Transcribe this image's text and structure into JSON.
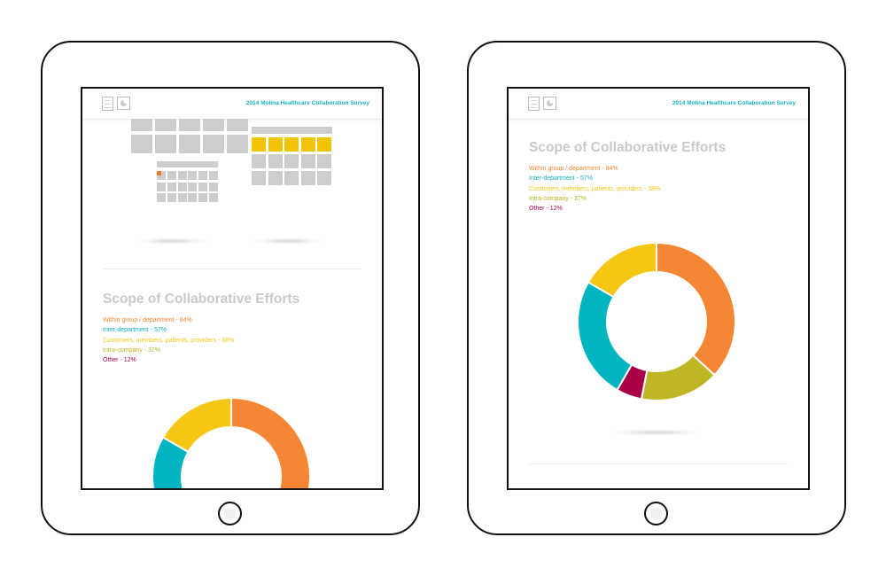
{
  "app": {
    "survey_title": "2014 Molina Healthcare Collaboration Survey",
    "icons": [
      "document-icon",
      "pie-chart-icon"
    ]
  },
  "section": {
    "title": "Scope of Collaborative Efforts"
  },
  "legend": [
    {
      "label": "Within group / department - 84%",
      "color": "#f58634"
    },
    {
      "label": "Inter-department - 57%",
      "color": "#13acbf"
    },
    {
      "label": "Customers, members, patients, providers - 38%",
      "color": "#f2c71b"
    },
    {
      "label": "Intra-company - 37%",
      "color": "#b8b020"
    },
    {
      "label": "Other - 12%",
      "color": "#a8004c"
    }
  ],
  "chart_data": {
    "type": "pie",
    "style": "donut",
    "categories": [
      "Within group / department",
      "Intra-company",
      "Other",
      "Inter-department",
      "Customers, members, patients, providers"
    ],
    "values": [
      84,
      37,
      12,
      57,
      38
    ],
    "colors": [
      "#f58634",
      "#bfb626",
      "#aa0048",
      "#00b5bf",
      "#f5c613"
    ]
  }
}
